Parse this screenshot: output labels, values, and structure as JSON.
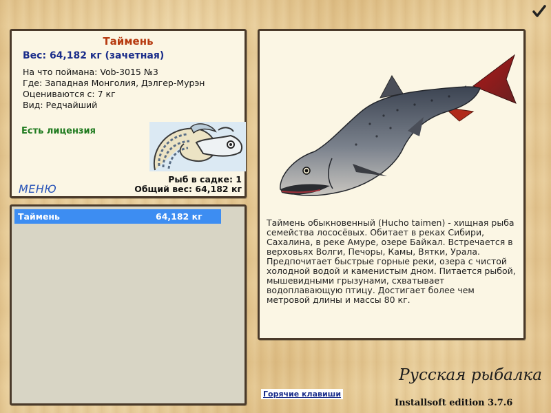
{
  "info": {
    "fish_name": "Таймень",
    "weight_line": "Вес: 64,182 кг (зачетная)",
    "caught_on": "На что поймана: Vob-3015 №3",
    "location": "Где: Западная Монголия, Дэлгер-Мурэн",
    "rated_from": "Оцениваются с: 7 кг",
    "rarity": "Вид: Редчайший",
    "license": "Есть лицензия",
    "menu_label": "МЕНЮ",
    "keep_count": "Рыб в садке: 1",
    "keep_weight": "Общий вес: 64,182 кг",
    "icon": "fish-emblem-icon"
  },
  "catch_list": [
    {
      "name": "Таймень",
      "weight": "64,182 кг"
    }
  ],
  "description": "Таймень обыкновенный (Hucho taimen) - хищная рыба семейства лососёвых. Обитает в реках Сибири, Сахалина, в реке Амуре, озере Байкал. Встречается в верховьях Волги, Печоры, Камы, Вятки, Урала. Предпочитает быстрые горные реки, озера с чистой холодной водой и каменистым дном. Питается рыбой, мышевидными грызунами, схватывает водоплавающую птицу. Достигает более чем метровой длины и массы 80 кг.",
  "footer": {
    "hotkeys": "Горячие клавиши",
    "brand": "Русская рыбалка",
    "edition": "Installsoft edition 3.7.6"
  },
  "colors": {
    "title": "#b63a10",
    "weight": "#1a2d8a",
    "license": "#1e7a1e",
    "menu": "#2a55b8",
    "selected_row": "#3d8df2"
  }
}
